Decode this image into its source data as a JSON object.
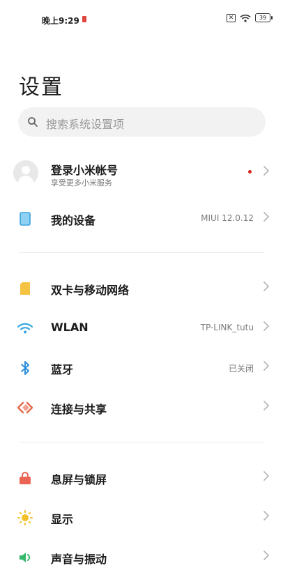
{
  "status_bar": {
    "time": "晚上9:29",
    "battery": "39",
    "sim_icon": "sim-off-icon",
    "wifi_icon": "wifi-icon"
  },
  "page": {
    "title": "设置"
  },
  "search": {
    "placeholder": "搜索系统设置项"
  },
  "account": {
    "title": "登录小米帐号",
    "subtitle": "享受更多小米服务"
  },
  "my_device": {
    "label": "我的设备",
    "value": "MIUI 12.0.12"
  },
  "network_section": [
    {
      "label": "双卡与移动网络",
      "value": "",
      "icon": "sim-card-icon",
      "color": "#f5c342"
    },
    {
      "label": "WLAN",
      "value": "TP-LINK_tutu",
      "icon": "wifi-icon",
      "color": "#33a7e0"
    },
    {
      "label": "蓝牙",
      "value": "已关闭",
      "icon": "bluetooth-icon",
      "color": "#2f8fdc"
    },
    {
      "label": "连接与共享",
      "value": "",
      "icon": "share-icon",
      "color": "#e2694c"
    }
  ],
  "display_section": [
    {
      "label": "息屏与锁屏",
      "value": "",
      "icon": "lock-icon",
      "color": "#ea6353"
    },
    {
      "label": "显示",
      "value": "",
      "icon": "sun-icon",
      "color": "#f4c02a"
    },
    {
      "label": "声音与振动",
      "value": "",
      "icon": "sound-icon",
      "color": "#35b86a"
    }
  ]
}
